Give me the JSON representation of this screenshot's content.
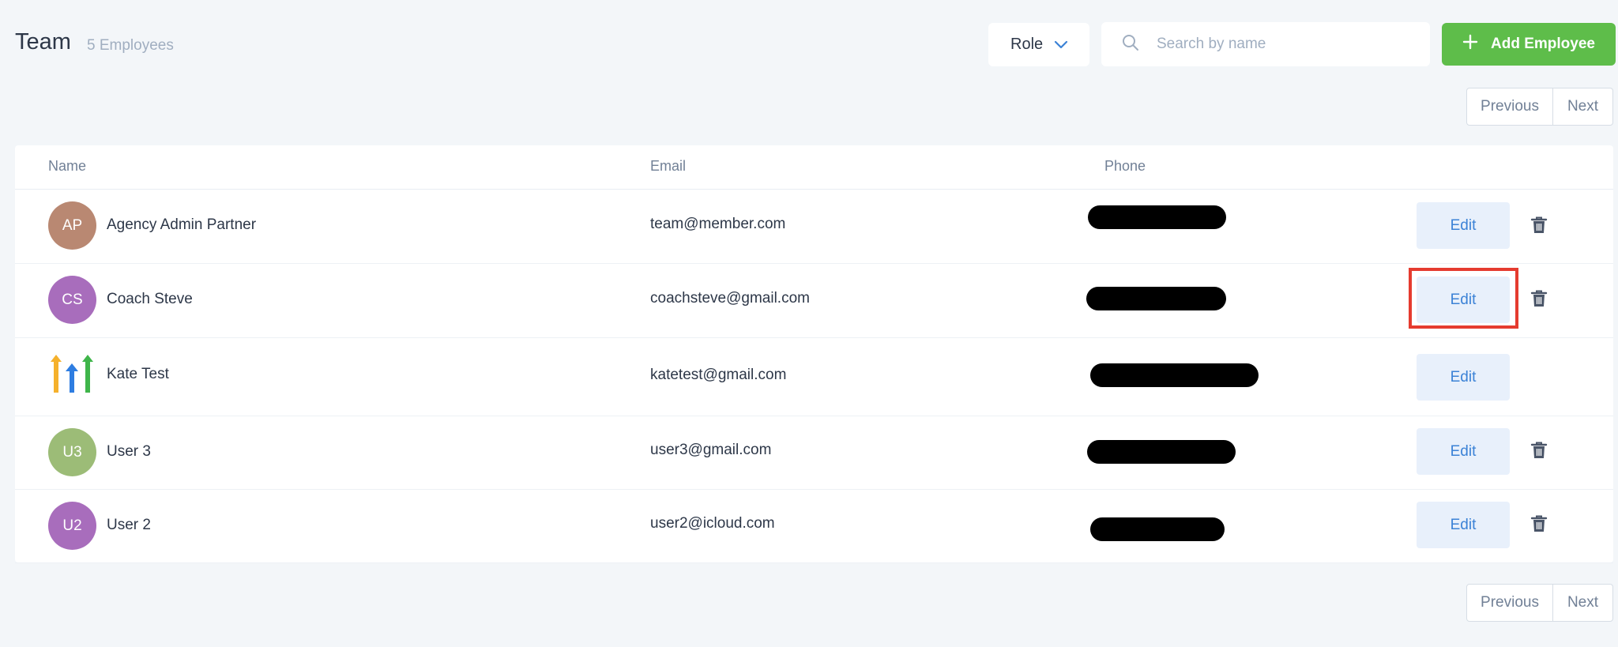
{
  "header": {
    "title": "Team",
    "count": "5 Employees",
    "role_label": "Role",
    "search_placeholder": "Search by name",
    "add_label": "Add Employee"
  },
  "pagination": {
    "previous": "Previous",
    "next": "Next"
  },
  "table": {
    "columns": {
      "name": "Name",
      "email": "Email",
      "phone": "Phone"
    },
    "rows": [
      {
        "initials": "AP",
        "name": "Agency Admin Partner",
        "email": "team@member.com",
        "avatar_color": "#b98872",
        "edit": "Edit",
        "deletable": true
      },
      {
        "initials": "CS",
        "name": "Coach Steve",
        "email": "coachsteve@gmail.com",
        "avatar_color": "#a86dbc",
        "edit": "Edit",
        "deletable": true,
        "highlighted": true
      },
      {
        "initials": "",
        "name": "Kate Test",
        "email": "katetest@gmail.com",
        "avatar_icon": "brand-logo-icon",
        "edit": "Edit",
        "deletable": false
      },
      {
        "initials": "U3",
        "name": "User 3",
        "email": "user3@gmail.com",
        "avatar_color": "#9cbc77",
        "edit": "Edit",
        "deletable": true
      },
      {
        "initials": "U2",
        "name": "User 2",
        "email": "user2@icloud.com",
        "avatar_color": "#a86dbc",
        "edit": "Edit",
        "deletable": true
      }
    ]
  },
  "colors": {
    "accent": "#3b82d6",
    "add_button": "#5ebd4a",
    "highlight": "#e53b2f"
  },
  "icons": {
    "search": "search-icon",
    "chevron": "chevron-down-icon",
    "plus": "plus-icon",
    "delete": "trash-icon"
  }
}
